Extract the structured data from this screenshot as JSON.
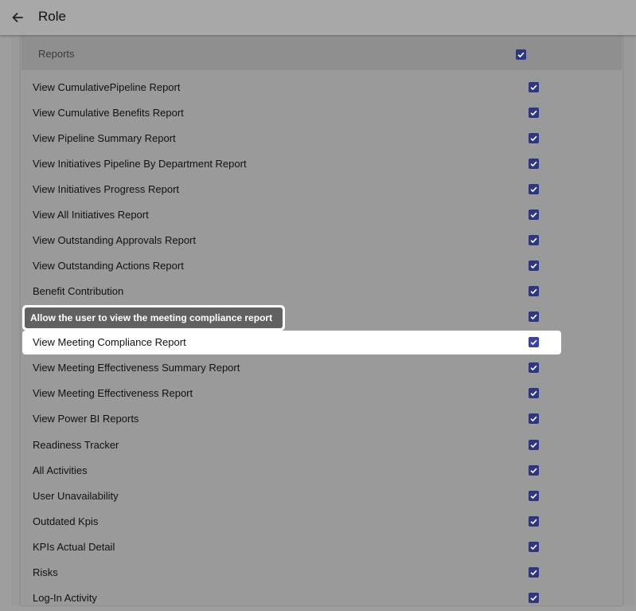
{
  "header": {
    "title": "Role",
    "back_icon": "arrow-left-icon"
  },
  "section": {
    "title": "Reports",
    "all_checked": true
  },
  "tooltip": {
    "text": "Allow the user to view the meeting compliance report"
  },
  "rows": [
    {
      "label": "View CumulativePipeline Report",
      "checked": true
    },
    {
      "label": "View Cumulative Benefits Report",
      "checked": true
    },
    {
      "label": "View Pipeline Summary Report",
      "checked": true
    },
    {
      "label": "View Initiatives Pipeline By Department Report",
      "checked": true
    },
    {
      "label": "View Initiatives Progress Report",
      "checked": true
    },
    {
      "label": "View All Initiatives Report",
      "checked": true
    },
    {
      "label": "View Outstanding Approvals Report",
      "checked": true
    },
    {
      "label": "View Outstanding Actions Report",
      "checked": true
    },
    {
      "label": "Benefit Contribution",
      "checked": true
    },
    {
      "label": "",
      "checked": true
    },
    {
      "label": "View Meeting Compliance Report",
      "checked": true
    },
    {
      "label": "View Meeting Effectiveness Summary Report",
      "checked": true
    },
    {
      "label": "View Meeting Effectiveness Report",
      "checked": true
    },
    {
      "label": "View Power BI Reports",
      "checked": true
    },
    {
      "label": "Readiness Tracker",
      "checked": true
    },
    {
      "label": "All Activities",
      "checked": true
    },
    {
      "label": "User Unavailability",
      "checked": true
    },
    {
      "label": "Outdated Kpis",
      "checked": true
    },
    {
      "label": "KPIs Actual Detail",
      "checked": true
    },
    {
      "label": "Risks",
      "checked": true
    },
    {
      "label": "Log-In Activity",
      "checked": true
    }
  ],
  "colors": {
    "checkbox": "#2f3680",
    "overlay_bg": "#9e9e9e",
    "highlight": "#ffffff",
    "tooltip_bg": "#616161"
  }
}
